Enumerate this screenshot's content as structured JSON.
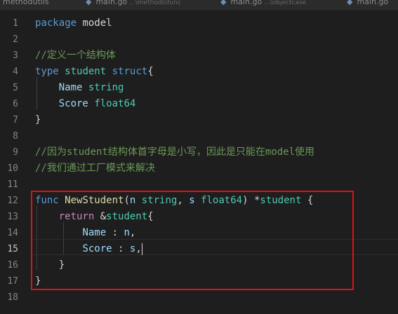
{
  "tabs": [
    {
      "label": "methodutils"
    },
    {
      "label": "main.go",
      "path": "...\\methods\\func"
    },
    {
      "label": "main.go",
      "path": "...\\objectcase"
    },
    {
      "label": "main.go"
    }
  ],
  "lines": [
    {
      "num": "1",
      "tokens": [
        {
          "cls": "k",
          "text": "package"
        },
        {
          "cls": "",
          "text": " model"
        }
      ]
    },
    {
      "num": "2",
      "tokens": []
    },
    {
      "num": "3",
      "tokens": [
        {
          "cls": "c",
          "text": "//定义一个结构体"
        }
      ]
    },
    {
      "num": "4",
      "tokens": [
        {
          "cls": "k",
          "text": "type"
        },
        {
          "cls": "",
          "text": " "
        },
        {
          "cls": "t",
          "text": "student"
        },
        {
          "cls": "",
          "text": " "
        },
        {
          "cls": "k",
          "text": "struct"
        },
        {
          "cls": "",
          "text": "{"
        }
      ]
    },
    {
      "num": "5",
      "tokens": [
        {
          "cls": "",
          "text": "    "
        },
        {
          "cls": "p",
          "text": "Name"
        },
        {
          "cls": "",
          "text": " "
        },
        {
          "cls": "t",
          "text": "string"
        }
      ]
    },
    {
      "num": "6",
      "tokens": [
        {
          "cls": "",
          "text": "    "
        },
        {
          "cls": "p",
          "text": "Score"
        },
        {
          "cls": "",
          "text": " "
        },
        {
          "cls": "t",
          "text": "float64"
        }
      ]
    },
    {
      "num": "7",
      "tokens": [
        {
          "cls": "",
          "text": "}"
        }
      ]
    },
    {
      "num": "8",
      "tokens": []
    },
    {
      "num": "9",
      "tokens": [
        {
          "cls": "c",
          "text": "//因为student结构体首字母是小写，因此是只能在model使用"
        }
      ]
    },
    {
      "num": "10",
      "tokens": [
        {
          "cls": "c",
          "text": "//我们通过工厂模式来解决"
        }
      ]
    },
    {
      "num": "11",
      "tokens": []
    },
    {
      "num": "12",
      "tokens": [
        {
          "cls": "k",
          "text": "func"
        },
        {
          "cls": "",
          "text": " "
        },
        {
          "cls": "f",
          "text": "NewStudent"
        },
        {
          "cls": "",
          "text": "("
        },
        {
          "cls": "p",
          "text": "n"
        },
        {
          "cls": "",
          "text": " "
        },
        {
          "cls": "t",
          "text": "string"
        },
        {
          "cls": "",
          "text": ", "
        },
        {
          "cls": "p",
          "text": "s"
        },
        {
          "cls": "",
          "text": " "
        },
        {
          "cls": "t",
          "text": "float64"
        },
        {
          "cls": "",
          "text": ") *"
        },
        {
          "cls": "t",
          "text": "student"
        },
        {
          "cls": "",
          "text": " {"
        }
      ]
    },
    {
      "num": "13",
      "tokens": [
        {
          "cls": "",
          "text": "    "
        },
        {
          "cls": "r",
          "text": "return"
        },
        {
          "cls": "",
          "text": " &"
        },
        {
          "cls": "t",
          "text": "student"
        },
        {
          "cls": "",
          "text": "{"
        }
      ]
    },
    {
      "num": "14",
      "tokens": [
        {
          "cls": "",
          "text": "        "
        },
        {
          "cls": "p",
          "text": "Name"
        },
        {
          "cls": "",
          "text": " : "
        },
        {
          "cls": "p",
          "text": "n"
        },
        {
          "cls": "",
          "text": ","
        }
      ]
    },
    {
      "num": "15",
      "tokens": [
        {
          "cls": "",
          "text": "        "
        },
        {
          "cls": "p",
          "text": "Score"
        },
        {
          "cls": "",
          "text": " : "
        },
        {
          "cls": "p",
          "text": "s"
        },
        {
          "cls": "",
          "text": ","
        }
      ],
      "active": true
    },
    {
      "num": "16",
      "tokens": [
        {
          "cls": "",
          "text": "    }"
        }
      ]
    },
    {
      "num": "17",
      "tokens": [
        {
          "cls": "",
          "text": "}"
        }
      ]
    },
    {
      "num": "18",
      "tokens": []
    }
  ],
  "highlight_color": "#e0101a"
}
